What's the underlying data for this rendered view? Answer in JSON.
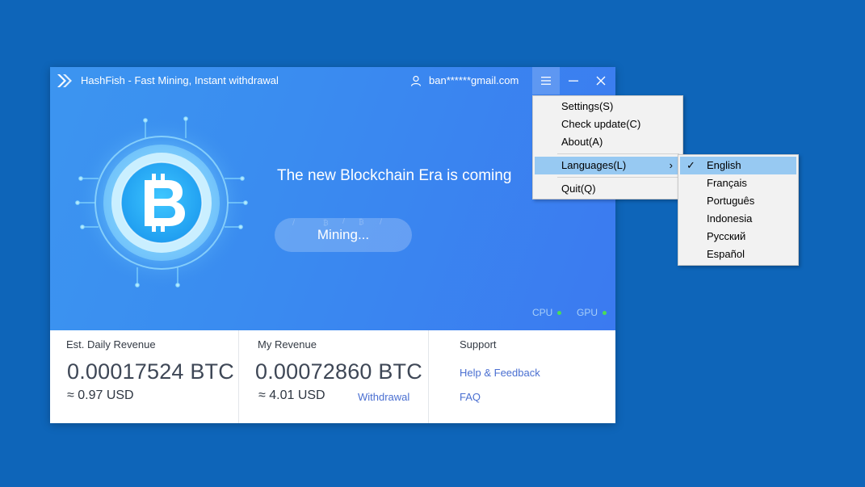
{
  "window": {
    "title": "HashFish - Fast Mining, Instant withdrawal",
    "user_email": "ban******gmail.com"
  },
  "hero": {
    "headline": "The new Blockchain Era is coming",
    "mining_button": "Mining...",
    "cpu_label": "CPU",
    "gpu_label": "GPU",
    "status_color": "#4cdd56"
  },
  "stats": {
    "daily": {
      "label": "Est. Daily Revenue",
      "btc": "0.00017524 BTC",
      "usd": "≈ 0.97 USD"
    },
    "my": {
      "label": "My Revenue",
      "btc": "0.00072860 BTC",
      "usd": "≈ 4.01 USD",
      "withdrawal": "Withdrawal"
    },
    "support": {
      "label": "Support",
      "help": "Help & Feedback",
      "faq": "FAQ"
    }
  },
  "main_menu": {
    "items": [
      {
        "label": "Settings(S)"
      },
      {
        "label": "Check update(C)"
      },
      {
        "label": "About(A)"
      },
      {
        "label": "Languages(L)",
        "submenu_arrow": "›",
        "highlighted": true
      },
      {
        "label": "Quit(Q)"
      }
    ]
  },
  "language_menu": {
    "selected_mark": "✓",
    "items": [
      {
        "label": "English",
        "selected": true
      },
      {
        "label": "Français"
      },
      {
        "label": "Português"
      },
      {
        "label": "Indonesia"
      },
      {
        "label": "Русский"
      },
      {
        "label": "Español"
      }
    ]
  },
  "colors": {
    "desktop": "#0e65b9",
    "hero_gradient_start": "#3c95f0",
    "hero_gradient_end": "#3b7af0",
    "menu_highlight": "#97c9f2",
    "link": "#4a6fd1"
  },
  "icons": {
    "logo": "hashfish-logo-icon",
    "user": "user-icon",
    "menu": "hamburger-icon",
    "minimize": "minimize-icon",
    "close": "close-icon",
    "coin": "bitcoin-icon"
  }
}
